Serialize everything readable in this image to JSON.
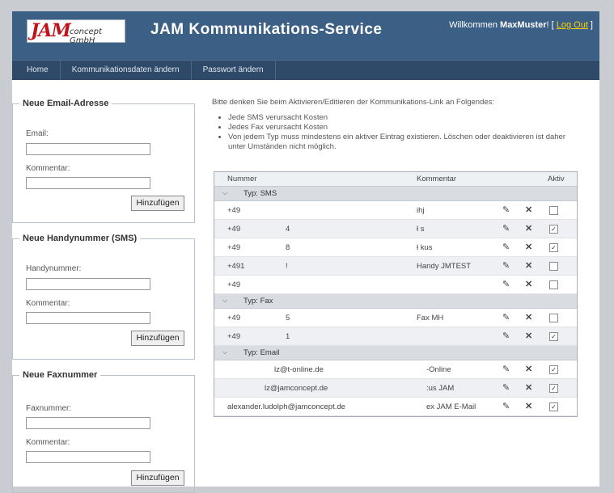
{
  "header": {
    "logo_main": "JAM",
    "logo_sub": "concept GmbH",
    "title": "JAM Kommunikations-Service",
    "welcome_prefix": "Willkommen ",
    "username": "MaxMuster",
    "sep_open": "! [ ",
    "logout": "Log Out",
    "sep_close": " ]"
  },
  "nav": [
    "Home",
    "Kommunikationsdaten ändern",
    "Passwort ändern"
  ],
  "forms": [
    {
      "legend": "Neue Email-Adresse",
      "field_label": "Email:",
      "comment_label": "Kommentar:",
      "button": "Hinzufügen"
    },
    {
      "legend": "Neue Handynummer (SMS)",
      "field_label": "Handynummer:",
      "comment_label": "Kommentar:",
      "button": "Hinzufügen"
    },
    {
      "legend": "Neue Faxnummer",
      "field_label": "Faxnummer:",
      "comment_label": "Kommentar:",
      "button": "Hinzufügen"
    }
  ],
  "notice": {
    "intro": "Bitte denken Sie beim Aktivieren/Editieren der Kommunikations-Link an Folgendes:",
    "bullets": [
      "Jede SMS verursacht Kosten",
      "Jedes Fax verursacht Kosten",
      "Von jedem Typ muss mindestens ein aktiver Eintrag existieren. Löschen oder deaktivieren ist daher unter Umständen nicht möglich."
    ]
  },
  "table": {
    "headers": {
      "number": "Nummer",
      "comment": "Kommentar",
      "active": "Aktiv"
    },
    "groups": [
      {
        "label": "Typ: SMS",
        "rows": [
          {
            "number": "+49",
            "mid": "",
            "comment": "ihj",
            "active": false
          },
          {
            "number": "+49",
            "mid": "4",
            "comment": "ł          s",
            "active": true
          },
          {
            "number": "+49",
            "mid": "8",
            "comment": "ł          kus",
            "active": true
          },
          {
            "number": "+491",
            "mid": "!",
            "comment": "Handy JMTEST",
            "active": false
          },
          {
            "number": "+49",
            "mid": "",
            "comment": "",
            "active": false
          }
        ]
      },
      {
        "label": "Typ: Fax",
        "rows": [
          {
            "number": "+49",
            "mid": "5",
            "comment": "Fax MH",
            "active": false
          },
          {
            "number": "+49",
            "mid": "1",
            "comment": "",
            "active": true
          }
        ]
      },
      {
        "label": "Typ: Email",
        "rows": [
          {
            "number": "lz@t-online.de",
            "mid": "",
            "comment": "-Online",
            "active": true
          },
          {
            "number": "lz@jamconcept.de",
            "mid": "",
            "comment": ":us JAM",
            "active": true
          },
          {
            "number": "alexander.ludolph@jamconcept.de",
            "mid": "",
            "comment": "ex JAM E-Mail",
            "active": true
          }
        ]
      }
    ]
  },
  "icons": {
    "edit": "pencil-icon",
    "delete": "x-icon",
    "expand": "chevron-down-icon"
  },
  "colors": {
    "header": "#3c5f86",
    "nav": "#2f4a69",
    "logout": "#ffd200",
    "logo_red": "#c0141b"
  }
}
